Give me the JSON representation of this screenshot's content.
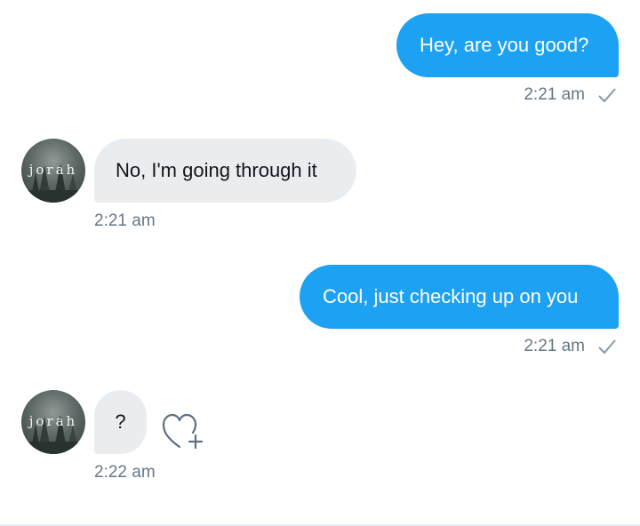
{
  "conversation": {
    "messages": [
      {
        "direction": "sent",
        "text": "Hey, are you good?",
        "time": "2:21 am",
        "status": "sent"
      },
      {
        "direction": "received",
        "sender": "jorah",
        "text": "No, I'm going through it",
        "time": "2:21 am"
      },
      {
        "direction": "sent",
        "text": "Cool, just checking up on you",
        "time": "2:21 am",
        "status": "sent"
      },
      {
        "direction": "received",
        "sender": "jorah",
        "text": "?",
        "time": "2:22 am"
      }
    ],
    "avatar_label": "jorah",
    "icons": {
      "check": "check-icon",
      "like": "heart-plus-icon"
    }
  },
  "colors": {
    "sent_bubble": "#1da1f2",
    "received_bubble": "#e9edf0",
    "meta_text": "#657786"
  }
}
